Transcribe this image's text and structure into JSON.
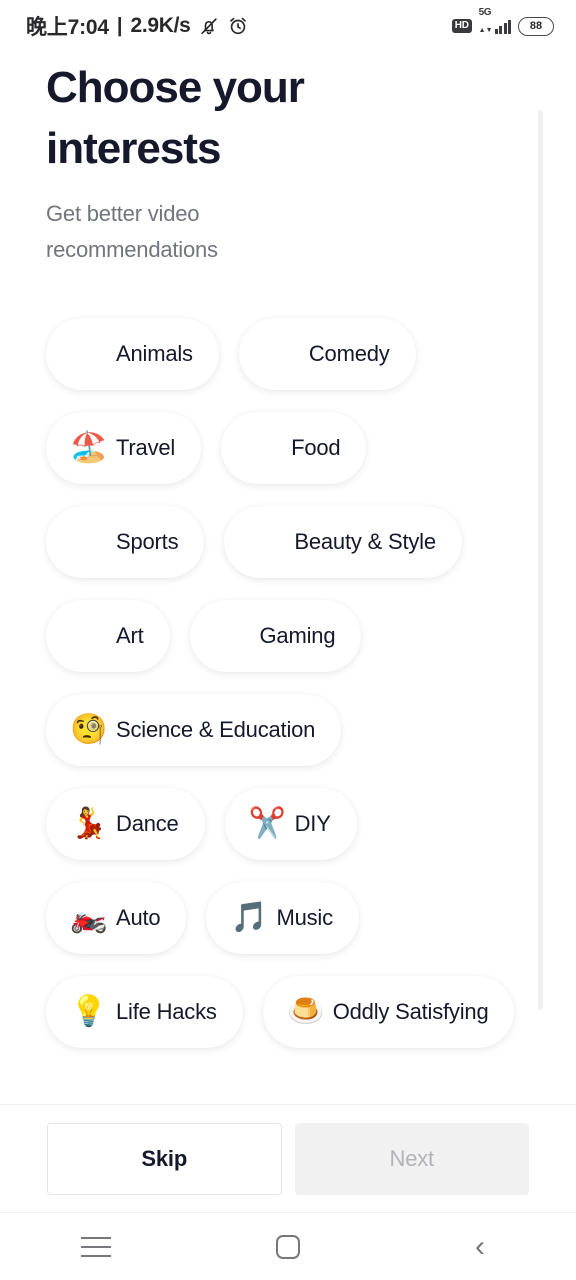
{
  "statusbar": {
    "time": "晚上7:04",
    "separator": "|",
    "network_speed": "2.9K/s",
    "mute_icon": "bell-muted-icon",
    "alarm_icon": "alarm-clock-icon",
    "hd_label": "HD",
    "network_type": "5G",
    "signal_bars": 4,
    "battery_level": "88"
  },
  "header": {
    "title": "Choose your interests",
    "subtitle": "Get better video recommendations"
  },
  "interests": [
    {
      "label": "Animals",
      "emoji": "",
      "icon": "missing-emoji-icon",
      "selected": false
    },
    {
      "label": "Comedy",
      "emoji": "",
      "icon": "missing-emoji-icon",
      "selected": false
    },
    {
      "label": "Travel",
      "emoji": "🏖️",
      "icon": "beach-umbrella-icon",
      "selected": false
    },
    {
      "label": "Food",
      "emoji": "",
      "icon": "missing-emoji-icon",
      "selected": false
    },
    {
      "label": "Sports",
      "emoji": "",
      "icon": "missing-emoji-icon",
      "selected": false
    },
    {
      "label": "Beauty & Style",
      "emoji": "",
      "icon": "missing-emoji-icon",
      "selected": false
    },
    {
      "label": "Art",
      "emoji": "",
      "icon": "missing-emoji-icon",
      "selected": false
    },
    {
      "label": "Gaming",
      "emoji": "",
      "icon": "missing-emoji-icon",
      "selected": false
    },
    {
      "label": "Science & Education",
      "emoji": "🧐",
      "icon": "monocle-face-icon",
      "selected": false
    },
    {
      "label": "Dance",
      "emoji": "💃",
      "icon": "dancer-icon",
      "selected": false
    },
    {
      "label": "DIY",
      "emoji": "✂️",
      "icon": "scissors-icon",
      "selected": false
    },
    {
      "label": "Auto",
      "emoji": "🏍️",
      "icon": "motorcycle-icon",
      "selected": false
    },
    {
      "label": "Music",
      "emoji": "🎵",
      "icon": "music-note-icon",
      "selected": false
    },
    {
      "label": "Life Hacks",
      "emoji": "💡",
      "icon": "light-bulb-icon",
      "selected": false
    },
    {
      "label": "Oddly Satisfying",
      "emoji": "🍮",
      "icon": "custard-pudding-icon",
      "selected": false
    }
  ],
  "actions": {
    "skip_label": "Skip",
    "next_label": "Next",
    "next_enabled": false
  },
  "navbar": {
    "recents_icon": "recents-menu-icon",
    "home_icon": "home-square-icon",
    "back_icon": "back-chevron-icon"
  },
  "colors": {
    "text_primary": "#16182b",
    "text_secondary": "#72757e",
    "chip_bg": "#ffffff",
    "next_disabled_bg": "#f1f1f2",
    "next_disabled_text": "#b2b3b7",
    "page_bg": "#ffffff"
  }
}
